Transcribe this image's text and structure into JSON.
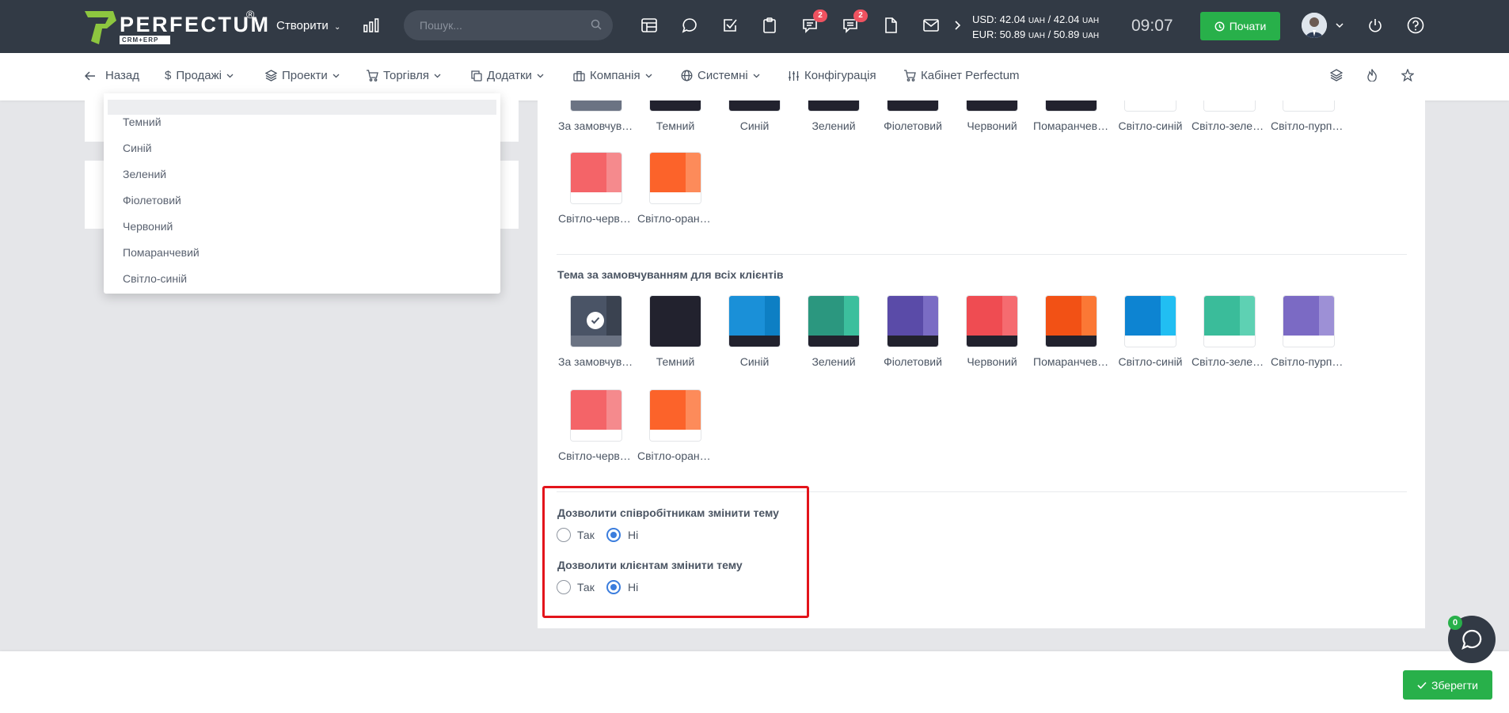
{
  "app": {
    "logo_text": "PERFECTUM",
    "logo_reg": "®",
    "logo_sub": "CRM+ERP"
  },
  "topbar": {
    "create_label": "Створити",
    "search_placeholder": "Пошук...",
    "badges": {
      "chat": "2",
      "messages": "2"
    },
    "rates": {
      "usd_prefix": "USD: 42.04",
      "usd_mid": "/ 42.04",
      "eur_prefix": "EUR: 50.89",
      "eur_mid": "/ 50.89",
      "unit": "UAH"
    },
    "time": "09:07",
    "start_label": "Почати"
  },
  "nav": {
    "back": "Назад",
    "sales": "Продажі",
    "projects": "Проекти",
    "trade": "Торгівля",
    "addons": "Додатки",
    "company": "Компанія",
    "system": "Системні",
    "config": "Конфігурація",
    "cabinet": "Кабінет Perfectum"
  },
  "dropdown": {
    "items": [
      "Темний",
      "Синій",
      "Зелений",
      "Фіолетовий",
      "Червоний",
      "Помаранчевий",
      "Світло-синій"
    ]
  },
  "themes": {
    "labels": [
      "За замовчуванням",
      "Темний",
      "Синій",
      "Зелений",
      "Фіолетовий",
      "Червоний",
      "Помаранчевий",
      "Світло-синій",
      "Світло-зелений",
      "Світло-пурпуровий",
      "Світло-червоний",
      "Світло-оранжевий"
    ],
    "clients_title": "Тема за замовчуванням для всіх клієнтів",
    "selected_index": 0,
    "colors": {
      "default": [
        "#4a5466",
        "#3a4250",
        "#6b7383"
      ],
      "dark": [
        "#22222e",
        "#22222e",
        "#22222e"
      ],
      "blue": [
        "#1a90d8",
        "#0d7fc4",
        "#22222e"
      ],
      "green": [
        "#2b977f",
        "#3cbf9d",
        "#22222e"
      ],
      "violet": [
        "#5a4ba8",
        "#7a6cc4",
        "#22222e"
      ],
      "red": [
        "#ef4c52",
        "#f56b70",
        "#22222e"
      ],
      "orange": [
        "#f25115",
        "#fb7835",
        "#22222e"
      ],
      "light_blue": [
        "#0d84d2",
        "#21bef2",
        "#ffffff"
      ],
      "light_green": [
        "#3abc9a",
        "#5ed1b3",
        "#ffffff"
      ],
      "light_purple": [
        "#7b6ac4",
        "#9d90d6",
        "#ffffff"
      ],
      "light_red": [
        "#f46468",
        "#f58a8d",
        "#ffffff"
      ],
      "light_orange": [
        "#fc632a",
        "#fd8b5a",
        "#ffffff"
      ]
    }
  },
  "permissions": {
    "employees_title": "Дозволити співробітникам змінити тему",
    "clients_title": "Дозволити клієнтам змінити тему",
    "yes": "Так",
    "no": "Ні",
    "employees_value": "no",
    "clients_value": "no"
  },
  "footer": {
    "save_label": "Зберегти",
    "chat_badge": "0"
  }
}
